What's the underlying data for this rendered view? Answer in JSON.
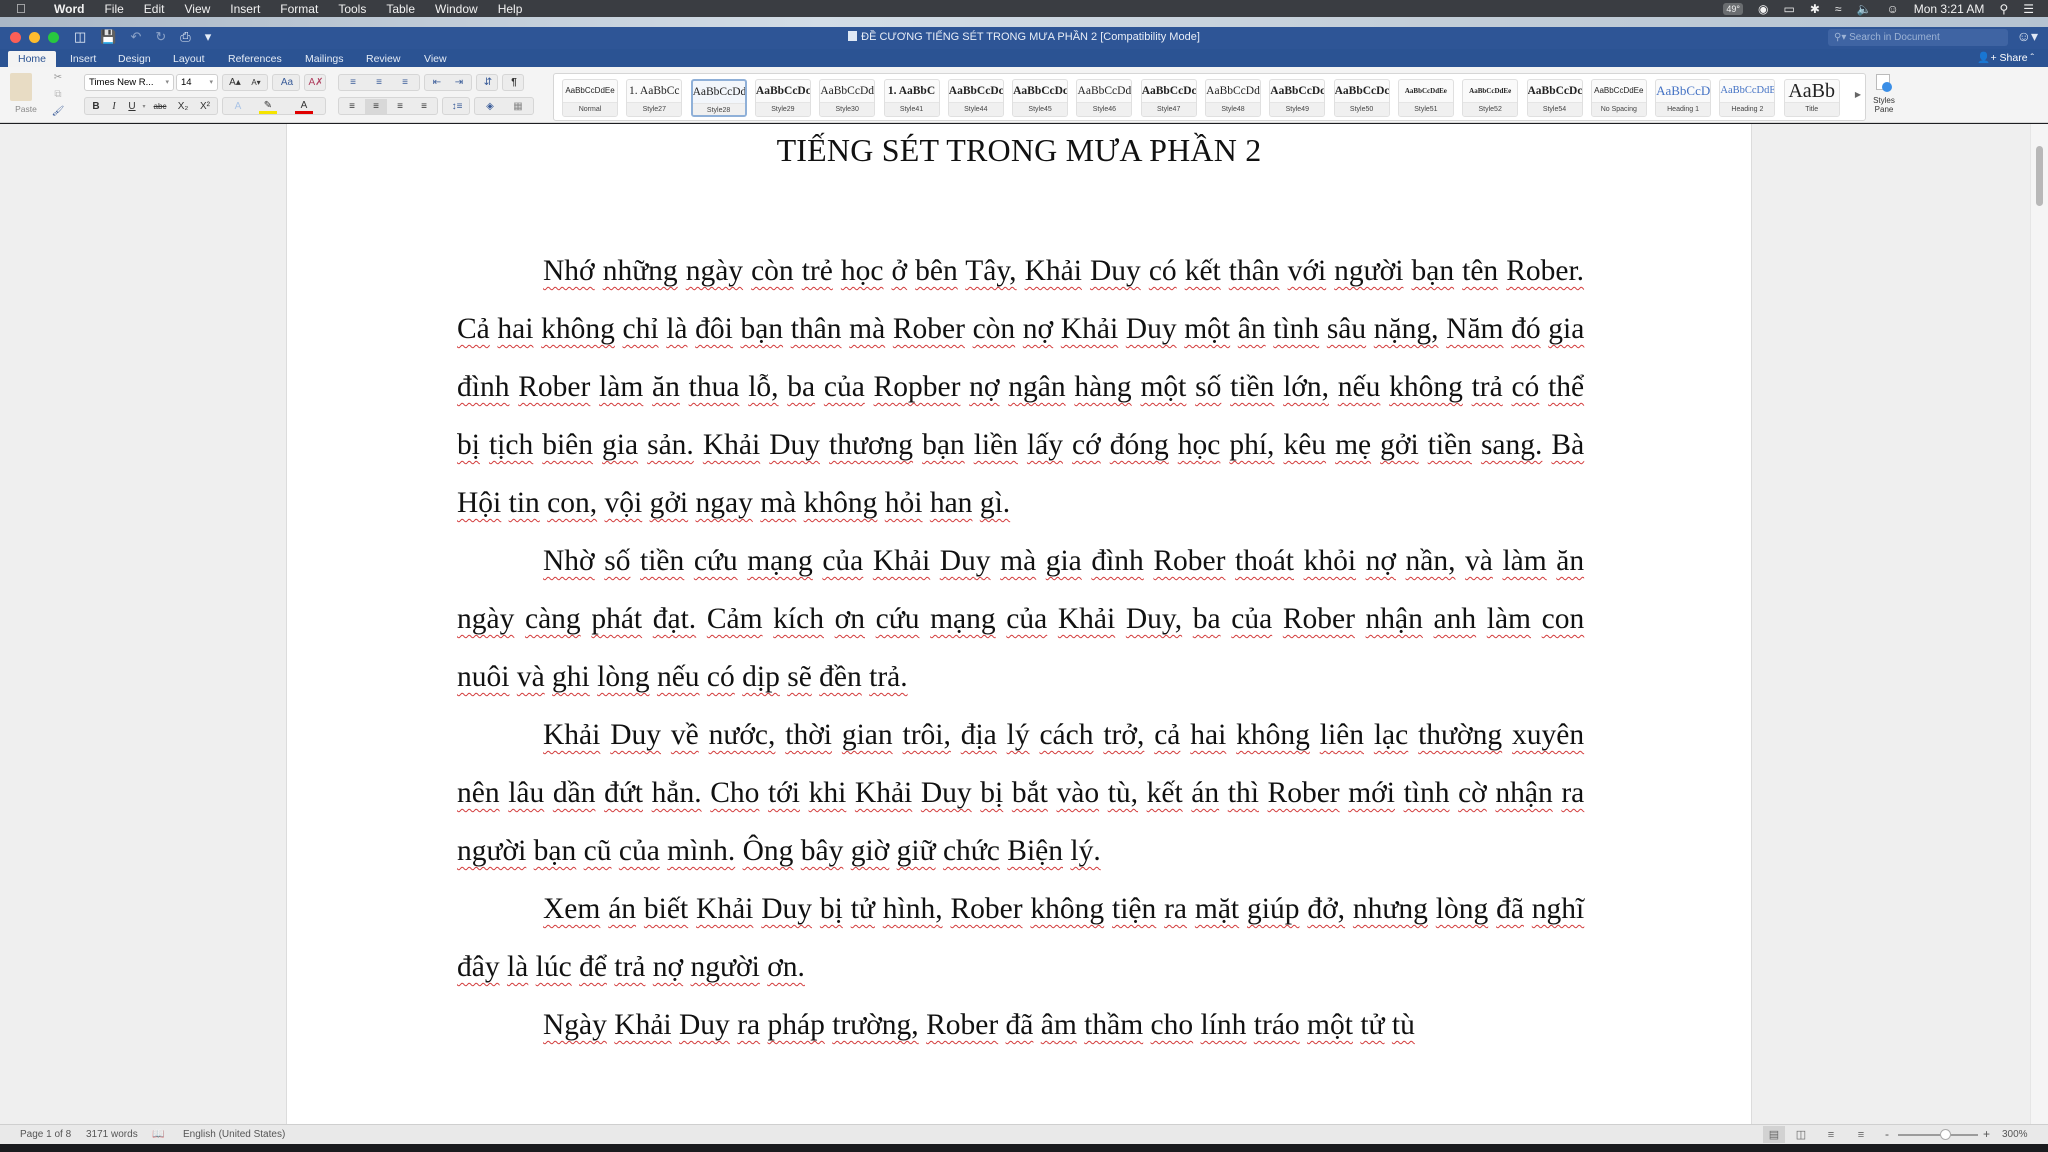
{
  "menubar": {
    "apple_icon": "",
    "items": [
      "Word",
      "File",
      "Edit",
      "View",
      "Insert",
      "Format",
      "Tools",
      "Table",
      "Window",
      "Help"
    ],
    "temperature": "49°",
    "clock": "Mon 3:21 AM"
  },
  "window": {
    "title": "ĐỀ CƯƠNG TIẾNG SÉT TRONG MƯA  PHẦN 2 [Compatibility Mode]",
    "search_placeholder": "Search in Document",
    "share_label": "Share"
  },
  "tabs": [
    {
      "label": "Home",
      "active": true
    },
    {
      "label": "Insert"
    },
    {
      "label": "Design"
    },
    {
      "label": "Layout"
    },
    {
      "label": "References"
    },
    {
      "label": "Mailings"
    },
    {
      "label": "Review"
    },
    {
      "label": "View"
    }
  ],
  "ribbon": {
    "paste_label": "Paste",
    "font_name": "Times New R...",
    "font_size": "14",
    "styles": [
      {
        "preview": "AaBbCcDdEe",
        "label": "Normal"
      },
      {
        "preview": "1.  AaBbCc",
        "label": "Style27"
      },
      {
        "preview": "AaBbCcDd",
        "label": "Style28",
        "selected": true
      },
      {
        "preview": "AaBbCcDc",
        "label": "Style29"
      },
      {
        "preview": "AaBbCcDd",
        "label": "Style30"
      },
      {
        "preview": "1.  AaBbC",
        "label": "Style41"
      },
      {
        "preview": "AaBbCcDc",
        "label": "Style44"
      },
      {
        "preview": "AaBbCcDc",
        "label": "Style45"
      },
      {
        "preview": "AaBbCcDd",
        "label": "Style46"
      },
      {
        "preview": "AaBbCcDc",
        "label": "Style47"
      },
      {
        "preview": "AaBbCcDd",
        "label": "Style48"
      },
      {
        "preview": "AaBbCcDc",
        "label": "Style49"
      },
      {
        "preview": "AaBbCcDc",
        "label": "Style50"
      },
      {
        "preview": "AaBbCcDdEe",
        "label": "Style51"
      },
      {
        "preview": "AaBbCcDdEe",
        "label": "Style52"
      },
      {
        "preview": "AaBbCcDc",
        "label": "Style54"
      },
      {
        "preview": "AaBbCcDdEe",
        "label": "No Spacing"
      },
      {
        "preview": "AaBbCcD",
        "label": "Heading 1"
      },
      {
        "preview": "AaBbCcDdE",
        "label": "Heading 2"
      },
      {
        "preview": "AaBb",
        "label": "Title"
      }
    ],
    "styles_pane_label": "Styles Pane",
    "heading_color": "#4472c4"
  },
  "document": {
    "title": "TIẾNG SÉT TRONG MƯA PHẦN 2",
    "paragraphs": [
      "Nhớ những ngày còn trẻ học ở bên Tây,  Khải Duy có kết thân với người bạn tên Rober. Cả hai không chỉ là đôi bạn thân mà Rober còn nợ Khải Duy một ân tình sâu nặng, Năm đó gia đình Rober làm ăn thua lỗ, ba của Ropber nợ ngân hàng một số tiền lớn, nếu không trả có thể bị tịch biên gia sản.  Khải Duy thương bạn liền lấy cớ đóng học phí, kêu mẹ gởi tiền sang.  Bà Hội tin con, vội gởi ngay mà không hỏi han gì.",
      "Nhờ số tiền cứu mạng của Khải Duy mà gia đình Rober thoát khỏi nợ nần, và làm ăn ngày càng phát đạt. Cảm kích ơn cứu mạng của Khải Duy, ba của Rober nhận anh làm con nuôi và ghi lòng nếu có dịp sẽ đền trả.",
      "Khải Duy về nước, thời gian trôi, địa lý cách trở, cả hai không liên lạc thường xuyên nên lâu dần đứt hẳn. Cho tới khi Khải Duy bị bắt vào tù, kết án thì Rober mới tình cờ nhận ra người bạn cũ của mình. Ông bây giờ giữ chức Biện lý.",
      "Xem án biết Khải Duy bị tử hình, Rober không tiện ra mặt giúp đở, nhưng lòng đã nghĩ đây là lúc để trả nợ người ơn.",
      " Ngày Khải Duy ra pháp trường, Rober đã âm thầm cho lính tráo một tử tù"
    ]
  },
  "status": {
    "page": "Page 1 of 8",
    "words": "3171 words",
    "language": "English (United States)",
    "zoom": "300%",
    "zoom_minus": "-",
    "zoom_plus": "+"
  }
}
